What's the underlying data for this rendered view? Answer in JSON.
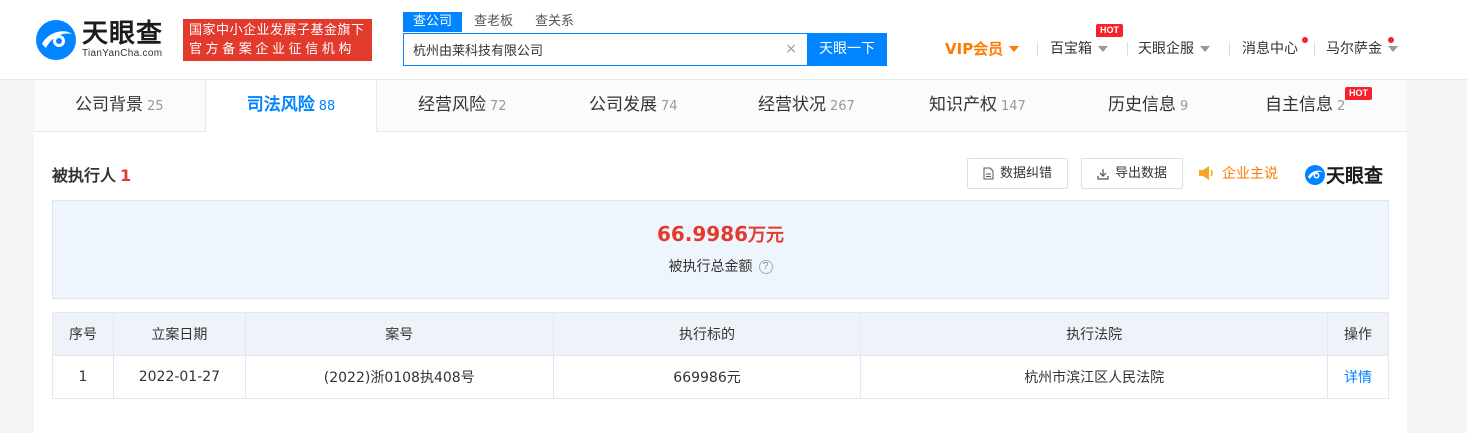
{
  "header": {
    "logo_cn": "天眼查",
    "logo_en": "TianYanCha.com",
    "slogan_line1": "国家中小企业发展子基金旗下",
    "slogan_line2": "官方备案企业征信机构",
    "search_tabs": [
      "查公司",
      "查老板",
      "查关系"
    ],
    "search_value": "杭州由莱科技有限公司",
    "search_button": "天眼一下",
    "clear_icon": "×",
    "nav": {
      "vip": "VIP会员",
      "baibaoxiang": "百宝箱",
      "hot_badge": "HOT",
      "qifu": "天眼企服",
      "messages": "消息中心",
      "user": "马尔萨金"
    }
  },
  "tabs": [
    {
      "label": "公司背景",
      "count": "25"
    },
    {
      "label": "司法风险",
      "count": "88"
    },
    {
      "label": "经营风险",
      "count": "72"
    },
    {
      "label": "公司发展",
      "count": "74"
    },
    {
      "label": "经营状况",
      "count": "267"
    },
    {
      "label": "知识产权",
      "count": "147"
    },
    {
      "label": "历史信息",
      "count": "9"
    },
    {
      "label": "自主信息",
      "count": "2"
    }
  ],
  "tab_hot_badge": "HOT",
  "section": {
    "title": "被执行人",
    "count": "1",
    "correct_button": "数据纠错",
    "export_button": "导出数据",
    "speak_label": "企业主说",
    "brand": "天眼查"
  },
  "summary": {
    "amount": "66.9986",
    "unit": "万元",
    "label": "被执行总金额",
    "help": "?"
  },
  "table": {
    "headers": [
      "序号",
      "立案日期",
      "案号",
      "执行标的",
      "执行法院",
      "操作"
    ],
    "rows": [
      [
        "1",
        "2022-01-27",
        "(2022)浙0108执408号",
        "669986元",
        "杭州市滨江区人民法院",
        "详情"
      ]
    ]
  },
  "colors": {
    "accent": "#0084ff",
    "red": "#e33a2e",
    "orange": "#ff7a00"
  }
}
